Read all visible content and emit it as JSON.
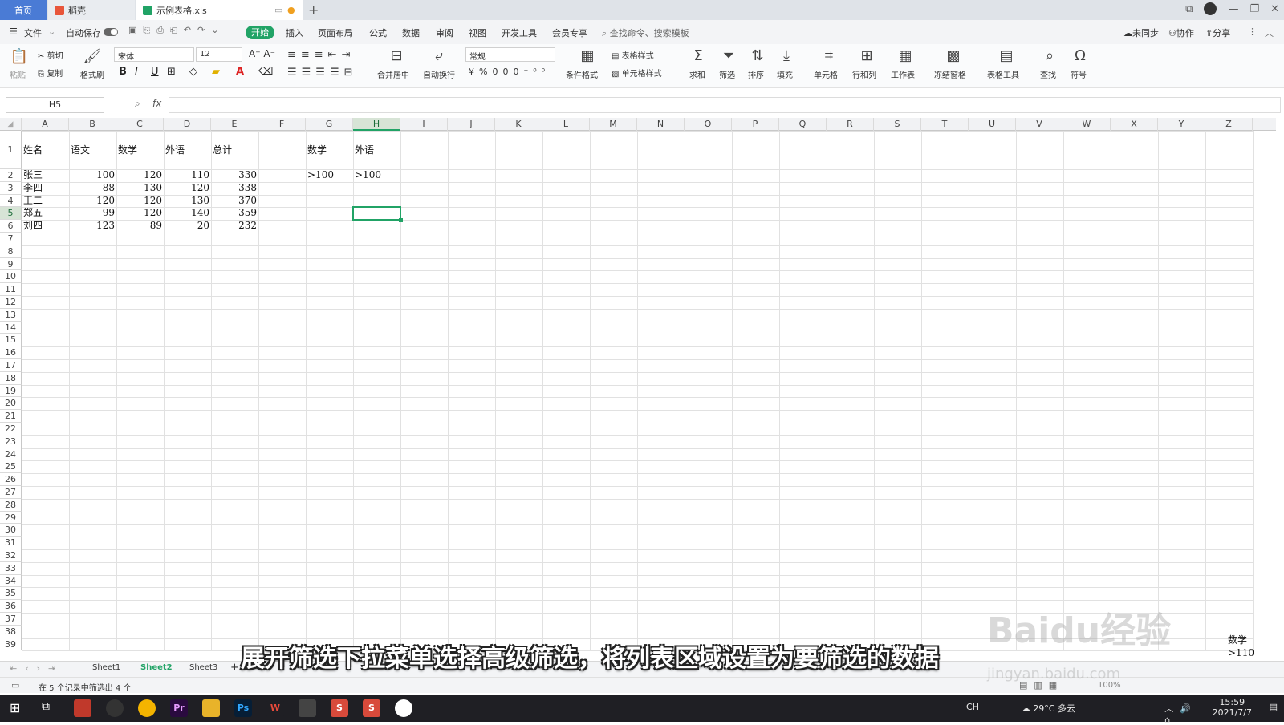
{
  "tabs": {
    "home": "首页",
    "daoke": "稻壳",
    "file": "示例表格.xls",
    "add": "+"
  },
  "menubar": {
    "file": "文件",
    "autosave": "自动保存",
    "start": "开始",
    "items": [
      "插入",
      "页面布局",
      "公式",
      "数据",
      "审阅",
      "视图",
      "开发工具",
      "会员专享"
    ],
    "search_placeholder": "查找命令、搜索模板",
    "sync": "未同步",
    "collab": "协作",
    "share": "分享"
  },
  "ribbon": {
    "cut": "剪切",
    "paste": "粘贴",
    "copy": "复制",
    "format_painter": "格式刷",
    "font_name": "宋体",
    "font_size": "12",
    "merge": "合并居中",
    "wrap": "自动换行",
    "number_format": "常规",
    "table_style": "表格样式",
    "cond_format": "条件格式",
    "cell_style": "单元格样式",
    "sum": "求和",
    "filter": "筛选",
    "sort": "排序",
    "fill": "填充",
    "cell": "单元格",
    "row_col": "行和列",
    "worksheet": "工作表",
    "freeze": "冻结窗格",
    "table_tools": "表格工具",
    "find": "查找",
    "symbol": "符号"
  },
  "formula": {
    "name_box": "H5",
    "fx": "fx",
    "value": ""
  },
  "grid": {
    "columns": [
      "A",
      "B",
      "C",
      "D",
      "E",
      "F",
      "G",
      "H",
      "I",
      "J",
      "K",
      "L",
      "M",
      "N",
      "O",
      "P",
      "Q",
      "R",
      "S",
      "T",
      "U",
      "V",
      "W",
      "X",
      "Y",
      "Z"
    ],
    "rows": [
      "1",
      "2",
      "3",
      "4",
      "5",
      "6",
      "7",
      "8",
      "9",
      "10",
      "11",
      "12",
      "13",
      "14",
      "15",
      "16",
      "17",
      "18",
      "19",
      "20",
      "21",
      "22",
      "23",
      "24",
      "25",
      "26",
      "27",
      "28",
      "29",
      "30",
      "31",
      "32",
      "33",
      "34",
      "35",
      "36",
      "37",
      "38",
      "39"
    ],
    "active_cell": "H5",
    "cells": {
      "A1": "姓名",
      "B1": "语文",
      "C1": "数学",
      "D1": "外语",
      "E1": "总计",
      "G1": "数学",
      "H1": "外语",
      "A2": "张三",
      "B2": "100",
      "C2": "120",
      "D2": "110",
      "E2": "330",
      "G2": ">100",
      "H2": ">100",
      "A3": "李四",
      "B3": "88",
      "C3": "130",
      "D3": "120",
      "E3": "338",
      "A4": "王二",
      "B4": "120",
      "C4": "120",
      "D4": "130",
      "E4": "370",
      "A5": "郑五",
      "B5": "99",
      "C5": "120",
      "D5": "140",
      "E5": "359",
      "A6": "刘四",
      "B6": "123",
      "C6": "89",
      "D6": "20",
      "E6": "232"
    },
    "corner_note": [
      "数学",
      ">110"
    ]
  },
  "sheets": {
    "tabs": [
      "Sheet1",
      "Sheet2",
      "Sheet3"
    ],
    "active": "Sheet2",
    "add": "+"
  },
  "status": {
    "text": "在 5 个记录中筛选出 4 个",
    "zoom": "100%"
  },
  "taskbar": {
    "apps": [
      "Pr",
      "Ps",
      "W",
      "S",
      "S"
    ],
    "lang": "CH",
    "weather": "29°C 多云",
    "time": "15:59",
    "date": "2021/7/7"
  },
  "overlay": {
    "subtitle": "展开筛选下拉菜单选择高级筛选，将列表区域设置为要筛选的数据",
    "watermark": "Baidu经验",
    "watermark_url": "jingyan.baidu.com"
  },
  "colors": {
    "accent": "#21a366",
    "home_tab": "#4a7bd5",
    "taskbar": "#1f1f24"
  }
}
